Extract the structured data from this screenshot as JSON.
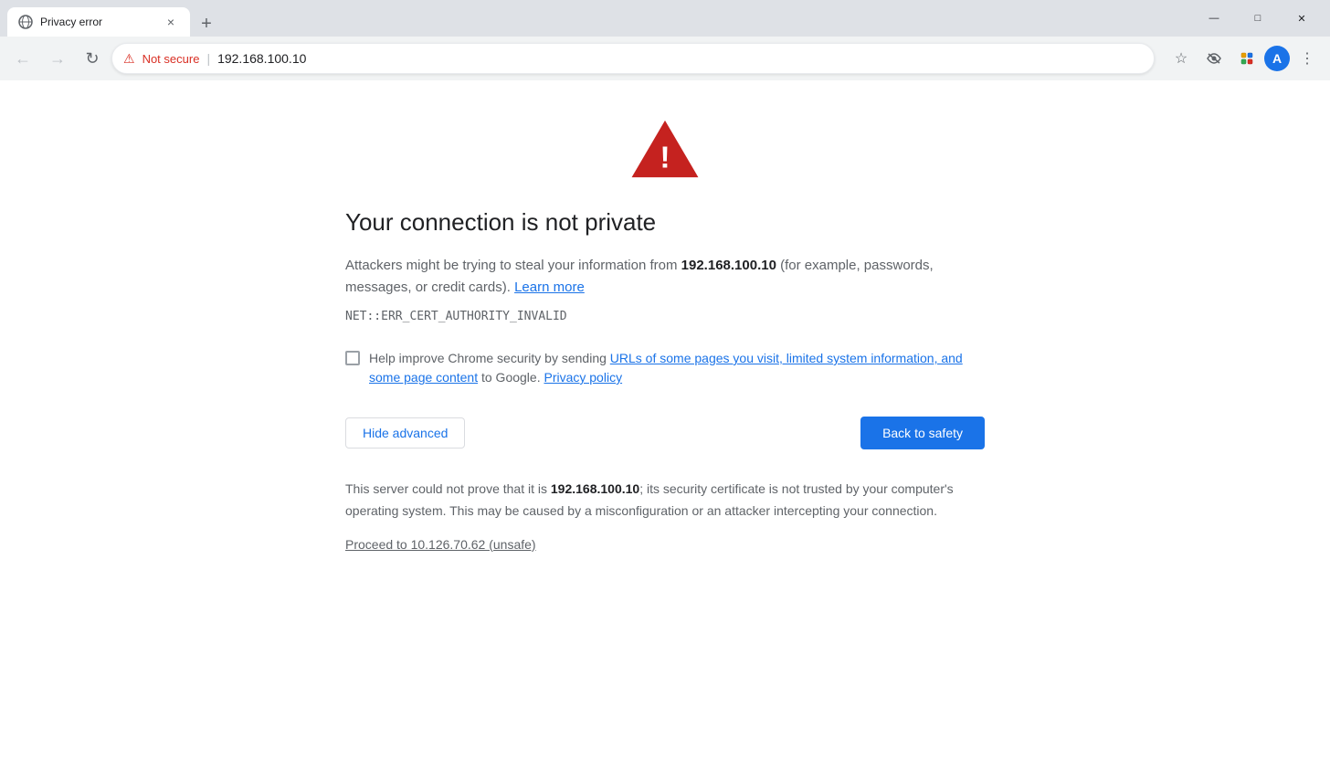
{
  "browser": {
    "tab": {
      "favicon": "🌐",
      "title": "Privacy error",
      "close_label": "×"
    },
    "new_tab_label": "+",
    "window_controls": {
      "minimize": "—",
      "maximize": "□",
      "close": "✕"
    },
    "nav": {
      "back_label": "←",
      "forward_label": "→",
      "reload_label": "↻",
      "not_secure_icon": "⚠",
      "not_secure_text": "Not secure",
      "separator": "|",
      "url": "192.168.100.10",
      "star_icon": "☆",
      "menu_icon": "⋮"
    }
  },
  "page": {
    "error_title": "Your connection is not private",
    "description_prefix": "Attackers might be trying to steal your information from ",
    "description_host": "192.168.100.10",
    "description_suffix": " (for example, passwords, messages, or credit cards).",
    "learn_more": "Learn more",
    "error_code": "NET::ERR_CERT_AUTHORITY_INVALID",
    "checkbox_text_prefix": "Help improve Chrome security by sending ",
    "checkbox_link": "URLs of some pages you visit, limited system information, and some page content",
    "checkbox_text_suffix": " to Google.",
    "privacy_policy": "Privacy policy",
    "hide_advanced_label": "Hide advanced",
    "back_to_safety_label": "Back to safety",
    "advanced_text_prefix": "This server could not prove that it is ",
    "advanced_host": "192.168.100.10",
    "advanced_text_suffix": "; its security certificate is not trusted by your computer's operating system. This may be caused by a misconfiguration or an attacker intercepting your connection.",
    "proceed_link": "Proceed to 10.126.70.62 (unsafe)"
  }
}
